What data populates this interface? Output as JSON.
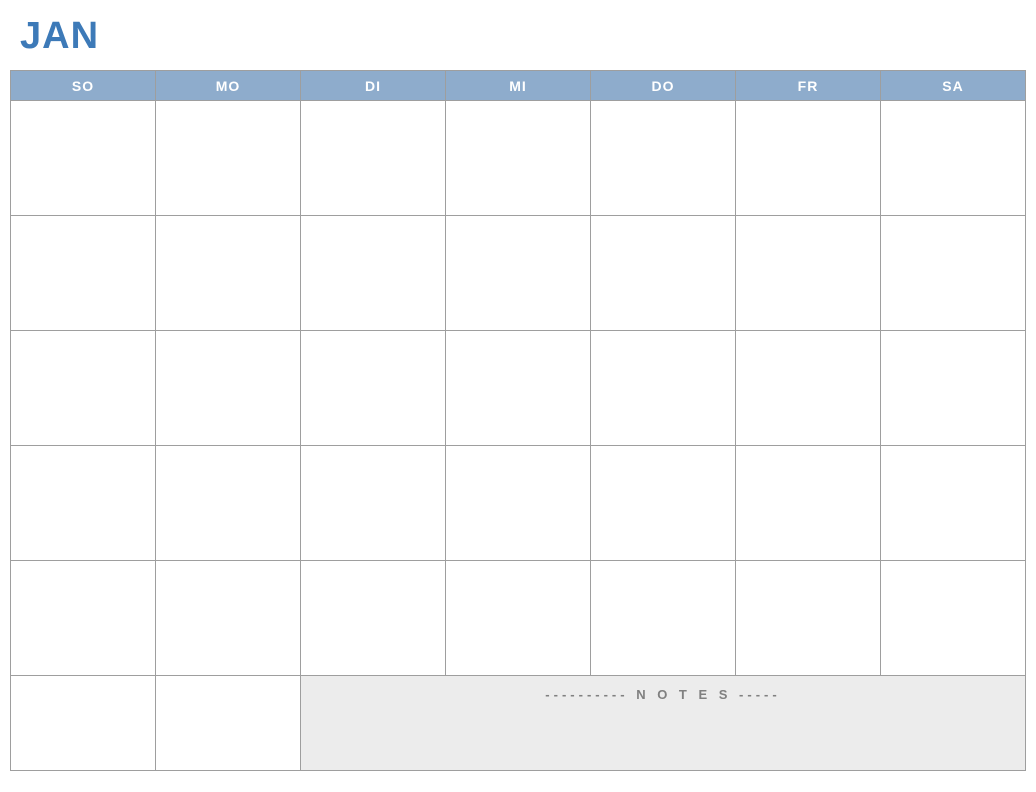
{
  "title": "JAN",
  "weekdays": [
    "SO",
    "MO",
    "DI",
    "MI",
    "DO",
    "FR",
    "SA"
  ],
  "notes_label": "---------- N O T E S -----"
}
